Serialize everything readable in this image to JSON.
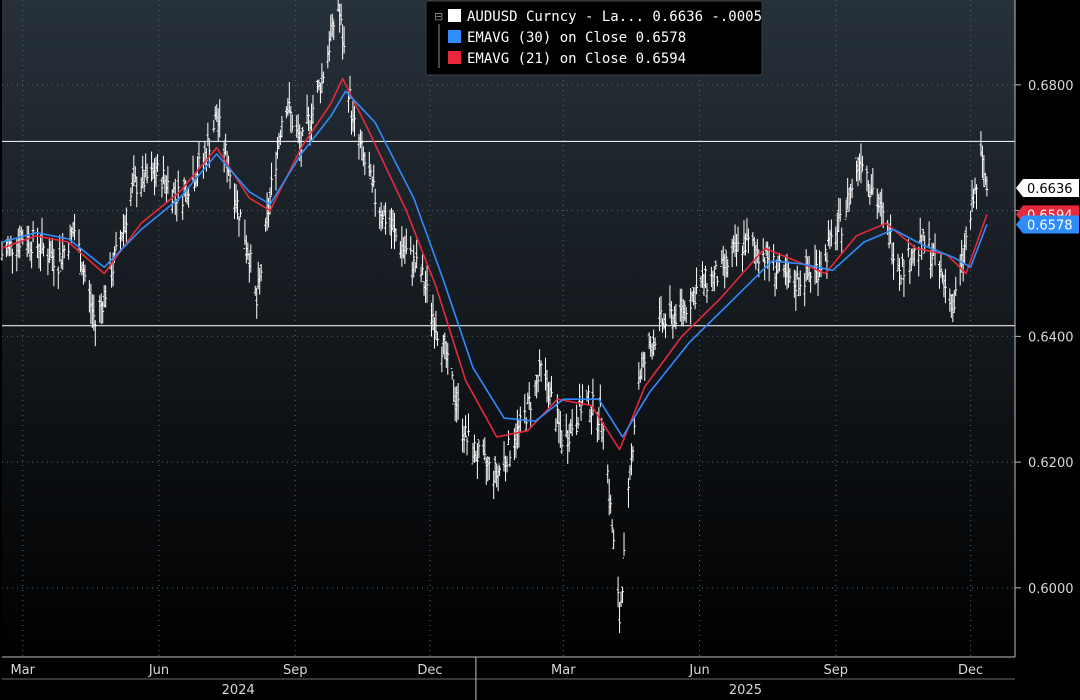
{
  "chart_data": {
    "type": "line",
    "title": "",
    "xlabel": "",
    "ylabel": "",
    "x_range": [
      "2024-02-16",
      "2025-12-31"
    ],
    "ylim": [
      0.589,
      0.6935
    ],
    "y_ticks": [
      0.6,
      0.62,
      0.64,
      0.66,
      0.68
    ],
    "y_tick_labels": [
      "0.6000",
      "0.6200",
      "0.6400",
      "0.6600",
      "0.6800"
    ],
    "x_ticks": [
      {
        "date": "2024-03-01",
        "label": "Mar"
      },
      {
        "date": "2024-06-01",
        "label": "Jun"
      },
      {
        "date": "2024-09-01",
        "label": "Sep"
      },
      {
        "date": "2024-12-01",
        "label": "Dec"
      },
      {
        "date": "2025-03-01",
        "label": "Mar"
      },
      {
        "date": "2025-06-01",
        "label": "Jun"
      },
      {
        "date": "2025-09-01",
        "label": "Sep"
      },
      {
        "date": "2025-12-01",
        "label": "Dec"
      }
    ],
    "year_labels": [
      {
        "label": "2024",
        "from": "2024-02-16",
        "to": "2024-12-31"
      },
      {
        "label": "2025",
        "from": "2025-01-01",
        "to": "2025-12-31"
      }
    ],
    "grid": true,
    "legend_position": "top-center",
    "legend": [
      {
        "marker": "white",
        "text": "AUDUSD Curncy - La... 0.6636  -.0005"
      },
      {
        "marker": "blue",
        "text": "EMAVG (30)  on Close 0.6578"
      },
      {
        "marker": "red",
        "text": "EMAVG (21)  on Close 0.6594"
      }
    ],
    "horizontal_lines": [
      0.671,
      0.6417
    ],
    "last_value_tags": [
      {
        "series": "AUDUSD Curncy",
        "label": "0.6636",
        "value": 0.6636,
        "color": "#ffffff",
        "text_color": "#000000"
      },
      {
        "series": "EMAVG (21)",
        "label": "0.6594",
        "value": 0.6594,
        "color": "#e8283c",
        "text_color": "#ffffff"
      },
      {
        "series": "EMAVG (30)",
        "label": "0.6578",
        "value": 0.6578,
        "color": "#2f8cff",
        "text_color": "#ffffff"
      }
    ],
    "series": [
      {
        "name": "AUDUSD Curncy",
        "style": "bars",
        "color": "#ffffff",
        "points": [
          {
            "x": "2024-02-16",
            "y": 0.653
          },
          {
            "x": "2024-03-01",
            "y": 0.656
          },
          {
            "x": "2024-03-15",
            "y": 0.654
          },
          {
            "x": "2024-03-25",
            "y": 0.652
          },
          {
            "x": "2024-04-05",
            "y": 0.657
          },
          {
            "x": "2024-04-19",
            "y": 0.642
          },
          {
            "x": "2024-05-01",
            "y": 0.651
          },
          {
            "x": "2024-05-15",
            "y": 0.664
          },
          {
            "x": "2024-06-01",
            "y": 0.666
          },
          {
            "x": "2024-06-15",
            "y": 0.662
          },
          {
            "x": "2024-07-01",
            "y": 0.668
          },
          {
            "x": "2024-07-10",
            "y": 0.675
          },
          {
            "x": "2024-07-20",
            "y": 0.665
          },
          {
            "x": "2024-08-01",
            "y": 0.653
          },
          {
            "x": "2024-08-06",
            "y": 0.645
          },
          {
            "x": "2024-08-15",
            "y": 0.662
          },
          {
            "x": "2024-08-25",
            "y": 0.678
          },
          {
            "x": "2024-09-05",
            "y": 0.67
          },
          {
            "x": "2024-09-20",
            "y": 0.682
          },
          {
            "x": "2024-09-30",
            "y": 0.693
          },
          {
            "x": "2024-10-10",
            "y": 0.674
          },
          {
            "x": "2024-10-25",
            "y": 0.662
          },
          {
            "x": "2024-11-10",
            "y": 0.655
          },
          {
            "x": "2024-11-25",
            "y": 0.65
          },
          {
            "x": "2024-12-10",
            "y": 0.638
          },
          {
            "x": "2024-12-25",
            "y": 0.624
          },
          {
            "x": "2025-01-05",
            "y": 0.62
          },
          {
            "x": "2025-01-15",
            "y": 0.618
          },
          {
            "x": "2025-02-01",
            "y": 0.626
          },
          {
            "x": "2025-02-15",
            "y": 0.635
          },
          {
            "x": "2025-03-01",
            "y": 0.623
          },
          {
            "x": "2025-03-15",
            "y": 0.63
          },
          {
            "x": "2025-03-28",
            "y": 0.627
          },
          {
            "x": "2025-04-08",
            "y": 0.595
          },
          {
            "x": "2025-04-20",
            "y": 0.633
          },
          {
            "x": "2025-05-05",
            "y": 0.642
          },
          {
            "x": "2025-05-20",
            "y": 0.644
          },
          {
            "x": "2025-06-01",
            "y": 0.648
          },
          {
            "x": "2025-06-15",
            "y": 0.65
          },
          {
            "x": "2025-07-01",
            "y": 0.655
          },
          {
            "x": "2025-07-15",
            "y": 0.653
          },
          {
            "x": "2025-08-01",
            "y": 0.648
          },
          {
            "x": "2025-08-20",
            "y": 0.651
          },
          {
            "x": "2025-09-05",
            "y": 0.658
          },
          {
            "x": "2025-09-18",
            "y": 0.669
          },
          {
            "x": "2025-10-01",
            "y": 0.66
          },
          {
            "x": "2025-10-15",
            "y": 0.651
          },
          {
            "x": "2025-11-01",
            "y": 0.655
          },
          {
            "x": "2025-11-20",
            "y": 0.645
          },
          {
            "x": "2025-12-01",
            "y": 0.659
          },
          {
            "x": "2025-12-08",
            "y": 0.668
          },
          {
            "x": "2025-12-12",
            "y": 0.6636
          }
        ]
      },
      {
        "name": "EMAVG (21)",
        "style": "line",
        "color": "#e8283c",
        "points": [
          {
            "x": "2024-02-16",
            "y": 0.654
          },
          {
            "x": "2024-03-10",
            "y": 0.656
          },
          {
            "x": "2024-04-01",
            "y": 0.655
          },
          {
            "x": "2024-04-25",
            "y": 0.65
          },
          {
            "x": "2024-05-20",
            "y": 0.658
          },
          {
            "x": "2024-06-15",
            "y": 0.663
          },
          {
            "x": "2024-07-10",
            "y": 0.67
          },
          {
            "x": "2024-08-01",
            "y": 0.662
          },
          {
            "x": "2024-08-15",
            "y": 0.66
          },
          {
            "x": "2024-09-05",
            "y": 0.67
          },
          {
            "x": "2024-09-25",
            "y": 0.677
          },
          {
            "x": "2024-10-03",
            "y": 0.681
          },
          {
            "x": "2024-10-20",
            "y": 0.673
          },
          {
            "x": "2024-11-15",
            "y": 0.66
          },
          {
            "x": "2024-12-05",
            "y": 0.648
          },
          {
            "x": "2024-12-25",
            "y": 0.633
          },
          {
            "x": "2025-01-15",
            "y": 0.624
          },
          {
            "x": "2025-02-05",
            "y": 0.625
          },
          {
            "x": "2025-02-25",
            "y": 0.63
          },
          {
            "x": "2025-03-20",
            "y": 0.629
          },
          {
            "x": "2025-04-08",
            "y": 0.622
          },
          {
            "x": "2025-04-25",
            "y": 0.632
          },
          {
            "x": "2025-05-20",
            "y": 0.64
          },
          {
            "x": "2025-06-15",
            "y": 0.646
          },
          {
            "x": "2025-07-15",
            "y": 0.654
          },
          {
            "x": "2025-08-05",
            "y": 0.652
          },
          {
            "x": "2025-08-25",
            "y": 0.65
          },
          {
            "x": "2025-09-15",
            "y": 0.656
          },
          {
            "x": "2025-10-05",
            "y": 0.658
          },
          {
            "x": "2025-10-25",
            "y": 0.654
          },
          {
            "x": "2025-11-15",
            "y": 0.653
          },
          {
            "x": "2025-11-28",
            "y": 0.65
          },
          {
            "x": "2025-12-12",
            "y": 0.6594
          }
        ]
      },
      {
        "name": "EMAVG (30)",
        "style": "line",
        "color": "#2f8cff",
        "points": [
          {
            "x": "2024-02-16",
            "y": 0.655
          },
          {
            "x": "2024-03-10",
            "y": 0.6565
          },
          {
            "x": "2024-04-01",
            "y": 0.6555
          },
          {
            "x": "2024-04-25",
            "y": 0.651
          },
          {
            "x": "2024-05-20",
            "y": 0.657
          },
          {
            "x": "2024-06-15",
            "y": 0.662
          },
          {
            "x": "2024-07-10",
            "y": 0.669
          },
          {
            "x": "2024-08-01",
            "y": 0.663
          },
          {
            "x": "2024-08-15",
            "y": 0.661
          },
          {
            "x": "2024-09-05",
            "y": 0.669
          },
          {
            "x": "2024-09-25",
            "y": 0.675
          },
          {
            "x": "2024-10-05",
            "y": 0.679
          },
          {
            "x": "2024-10-25",
            "y": 0.674
          },
          {
            "x": "2024-11-20",
            "y": 0.662
          },
          {
            "x": "2024-12-10",
            "y": 0.649
          },
          {
            "x": "2024-12-30",
            "y": 0.635
          },
          {
            "x": "2025-01-20",
            "y": 0.627
          },
          {
            "x": "2025-02-10",
            "y": 0.6265
          },
          {
            "x": "2025-03-01",
            "y": 0.63
          },
          {
            "x": "2025-03-25",
            "y": 0.63
          },
          {
            "x": "2025-04-10",
            "y": 0.624
          },
          {
            "x": "2025-04-28",
            "y": 0.631
          },
          {
            "x": "2025-05-25",
            "y": 0.639
          },
          {
            "x": "2025-06-20",
            "y": 0.645
          },
          {
            "x": "2025-07-20",
            "y": 0.652
          },
          {
            "x": "2025-08-10",
            "y": 0.6515
          },
          {
            "x": "2025-08-30",
            "y": 0.6505
          },
          {
            "x": "2025-09-20",
            "y": 0.655
          },
          {
            "x": "2025-10-10",
            "y": 0.657
          },
          {
            "x": "2025-10-30",
            "y": 0.6545
          },
          {
            "x": "2025-11-20",
            "y": 0.6525
          },
          {
            "x": "2025-12-01",
            "y": 0.651
          },
          {
            "x": "2025-12-12",
            "y": 0.6578
          }
        ]
      }
    ]
  }
}
